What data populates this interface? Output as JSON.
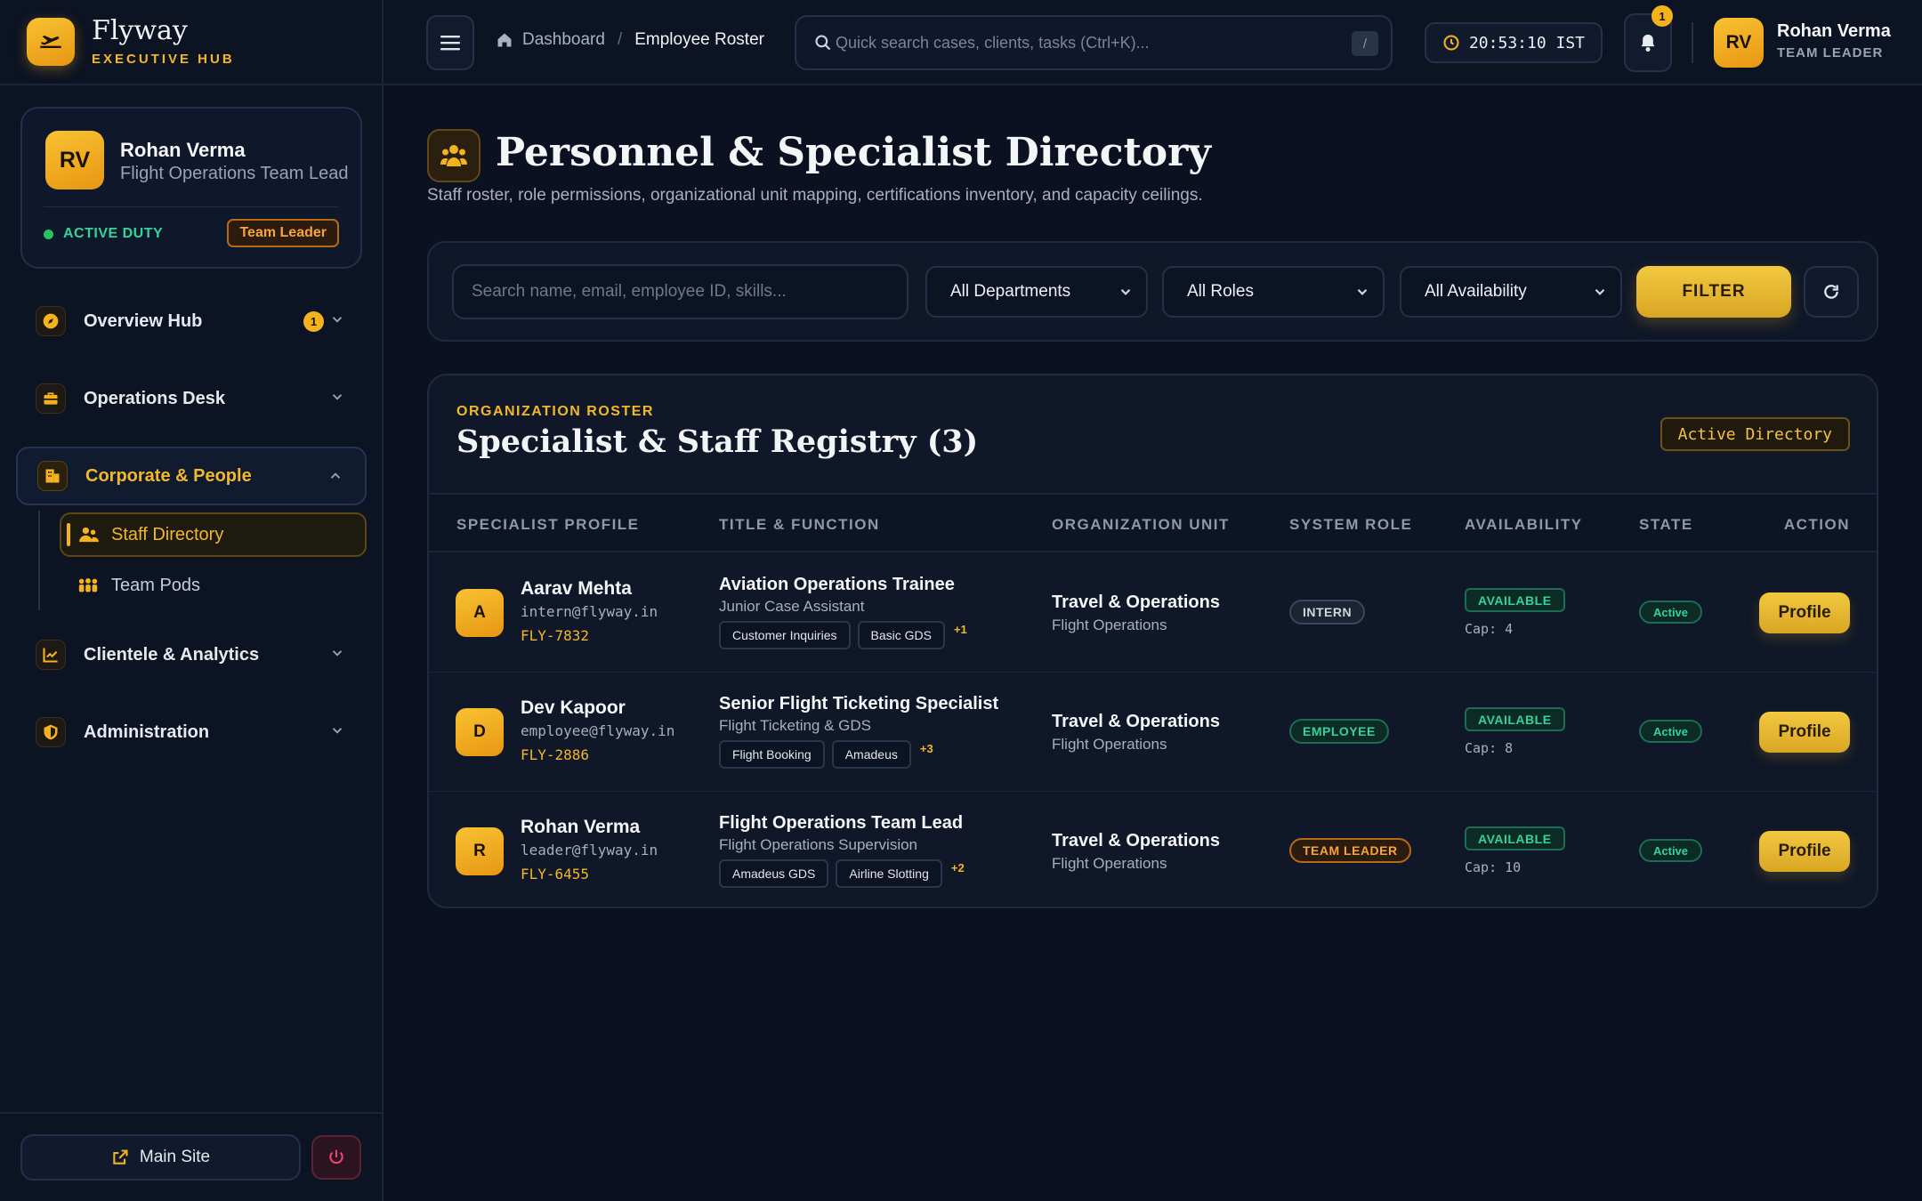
{
  "brand": {
    "name": "Flyway",
    "subtitle": "EXECUTIVE HUB"
  },
  "user_card": {
    "initials": "RV",
    "name": "Rohan Verma",
    "role": "Flight Operations Team Lead",
    "status": "ACTIVE DUTY",
    "badge": "Team Leader"
  },
  "nav": {
    "items": [
      {
        "label": "Overview Hub",
        "badge": "1",
        "icon": "compass-icon"
      },
      {
        "label": "Operations Desk",
        "icon": "briefcase-icon"
      },
      {
        "label": "Corporate & People",
        "icon": "building-icon"
      },
      {
        "label": "Clientele & Analytics",
        "icon": "chart-line-icon"
      },
      {
        "label": "Administration",
        "icon": "shield-icon"
      }
    ],
    "sub_items": [
      {
        "label": "Staff Directory",
        "icon": "users-icon"
      },
      {
        "label": "Team Pods",
        "icon": "people-group-icon"
      }
    ]
  },
  "footer": {
    "main_site": "Main Site"
  },
  "topbar": {
    "breadcrumb_home": "Dashboard",
    "breadcrumb_sep": "/",
    "breadcrumb_current": "Employee Roster",
    "search_placeholder": "Quick search cases, clients, tasks (Ctrl+K)...",
    "shortcut": "/",
    "clock": "20:53:10 IST",
    "notifications": "1",
    "user_initials": "RV",
    "user_name": "Rohan Verma",
    "user_role": "TEAM LEADER"
  },
  "page": {
    "title": "Personnel & Specialist Directory",
    "subtitle": "Staff roster, role permissions, organizational unit mapping, certifications inventory, and capacity ceilings."
  },
  "filters": {
    "search_placeholder": "Search name, email, employee ID, skills...",
    "department": "All Departments",
    "role": "All Roles",
    "availability": "All Availability",
    "filter_button": "FILTER"
  },
  "registry": {
    "eyebrow": "ORGANIZATION ROSTER",
    "title": "Specialist & Staff Registry (3)",
    "badge": "Active Directory",
    "columns": [
      "SPECIALIST PROFILE",
      "TITLE & FUNCTION",
      "ORGANIZATION UNIT",
      "SYSTEM ROLE",
      "AVAILABILITY",
      "STATE",
      "ACTION"
    ],
    "rows": [
      {
        "initial": "A",
        "name": "Aarav Mehta",
        "email": "intern@flyway.in",
        "id": "FLY-7832",
        "title": "Aviation Operations Trainee",
        "function": "Junior Case Assistant",
        "skills": [
          "Customer Inquiries",
          "Basic GDS"
        ],
        "more": "+1",
        "unit": "Travel & Operations",
        "unit_sub": "Flight Operations",
        "role": "INTERN",
        "availability": "AVAILABLE",
        "cap": "Cap: 4",
        "state": "Active",
        "action": "Profile"
      },
      {
        "initial": "D",
        "name": "Dev Kapoor",
        "email": "employee@flyway.in",
        "id": "FLY-2886",
        "title": "Senior Flight Ticketing Specialist",
        "function": "Flight Ticketing & GDS",
        "skills": [
          "Flight Booking",
          "Amadeus"
        ],
        "more": "+3",
        "unit": "Travel & Operations",
        "unit_sub": "Flight Operations",
        "role": "EMPLOYEE",
        "availability": "AVAILABLE",
        "cap": "Cap: 8",
        "state": "Active",
        "action": "Profile"
      },
      {
        "initial": "R",
        "name": "Rohan Verma",
        "email": "leader@flyway.in",
        "id": "FLY-6455",
        "title": "Flight Operations Team Lead",
        "function": "Flight Operations Supervision",
        "skills": [
          "Amadeus GDS",
          "Airline Slotting"
        ],
        "more": "+2",
        "unit": "Travel & Operations",
        "unit_sub": "Flight Operations",
        "role": "TEAM LEADER",
        "availability": "AVAILABLE",
        "cap": "Cap: 10",
        "state": "Active",
        "action": "Profile"
      }
    ]
  }
}
